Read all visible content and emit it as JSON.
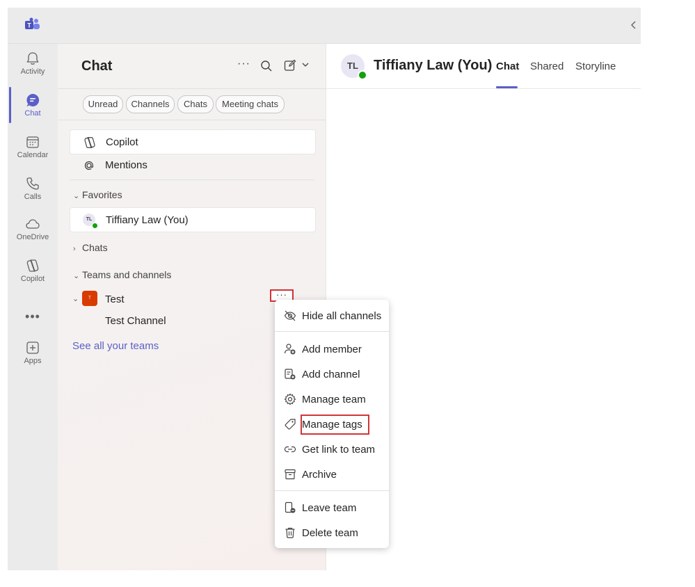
{
  "window": {
    "app_logo": "teams-logo-icon",
    "collapse_icon": "chevron-left-icon"
  },
  "rail": {
    "items": [
      {
        "label": "Activity",
        "icon": "bell-icon"
      },
      {
        "label": "Chat",
        "icon": "chat-bubble-icon"
      },
      {
        "label": "Calendar",
        "icon": "calendar-icon"
      },
      {
        "label": "Calls",
        "icon": "phone-icon"
      },
      {
        "label": "OneDrive",
        "icon": "cloud-icon"
      },
      {
        "label": "Copilot",
        "icon": "copilot-icon"
      },
      {
        "label": "Apps",
        "icon": "add-square-icon"
      }
    ],
    "more": "•••",
    "accent": "#5b5fc7"
  },
  "sidebar": {
    "title": "Chat",
    "more": "···",
    "filters": [
      "Unread",
      "Channels",
      "Chats",
      "Meeting chats"
    ],
    "copilot": "Copilot",
    "mentions": "Mentions",
    "favorites_label": "Favorites",
    "favorite_item": {
      "initials": "TL",
      "name": "Tiffiany Law (You)"
    },
    "chats_label": "Chats",
    "teams_label": "Teams and channels",
    "team": {
      "initial": "T",
      "name": "Test",
      "more": "···",
      "color": "#d83b01"
    },
    "channel": "Test Channel",
    "see_all": "See all your teams"
  },
  "main": {
    "initials": "TL",
    "name": "Tiffiany Law (You)",
    "tabs": [
      "Chat",
      "Shared",
      "Storyline"
    ],
    "active_tab": "Chat"
  },
  "context_menu": {
    "items": [
      {
        "label": "Hide all channels",
        "icon": "eye-off-icon"
      },
      {
        "label": "Add member",
        "icon": "person-add-icon"
      },
      {
        "label": "Add channel",
        "icon": "channel-add-icon"
      },
      {
        "label": "Manage team",
        "icon": "gear-icon"
      },
      {
        "label": "Manage tags",
        "icon": "tag-icon"
      },
      {
        "label": "Get link to team",
        "icon": "link-icon"
      },
      {
        "label": "Archive",
        "icon": "archive-icon"
      },
      {
        "label": "Leave team",
        "icon": "leave-icon"
      },
      {
        "label": "Delete team",
        "icon": "trash-icon"
      }
    ],
    "highlighted": "Manage tags",
    "highlight_color": "#d13438"
  }
}
